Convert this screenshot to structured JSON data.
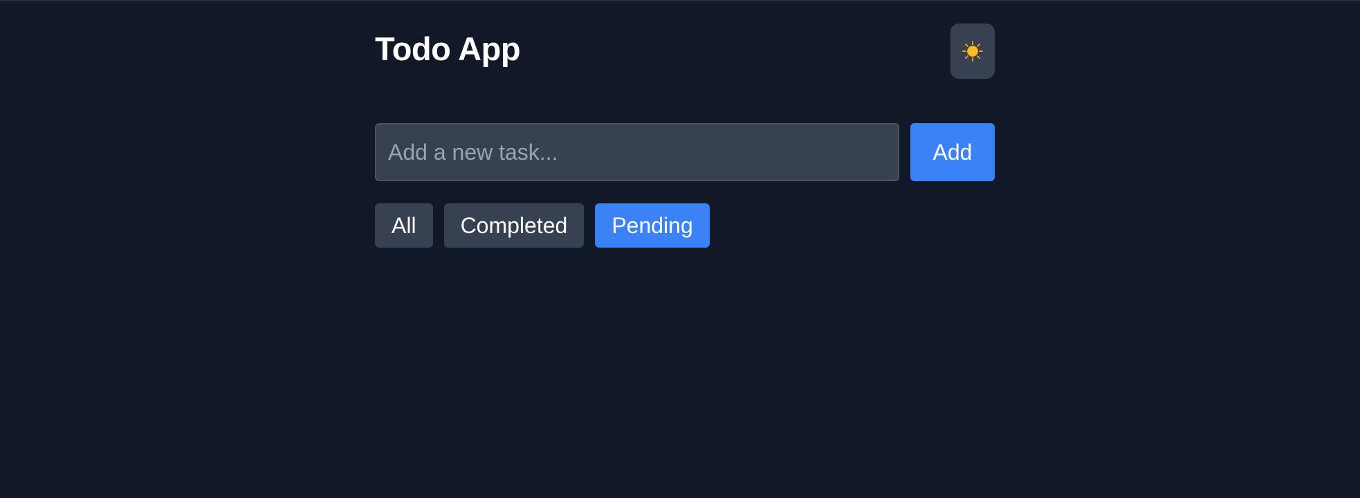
{
  "app": {
    "title": "Todo App",
    "theme_toggle_icon": "sun-icon"
  },
  "add_task": {
    "input_value": "",
    "input_placeholder": "Add a new task...",
    "add_label": "Add"
  },
  "filters": {
    "active": "Pending",
    "items": [
      {
        "label": "All"
      },
      {
        "label": "Completed"
      },
      {
        "label": "Pending"
      }
    ]
  },
  "colors": {
    "background": "#111827",
    "surface": "#374151",
    "accent": "#3b82f6",
    "text": "#ffffff",
    "placeholder": "#9ca3af"
  }
}
